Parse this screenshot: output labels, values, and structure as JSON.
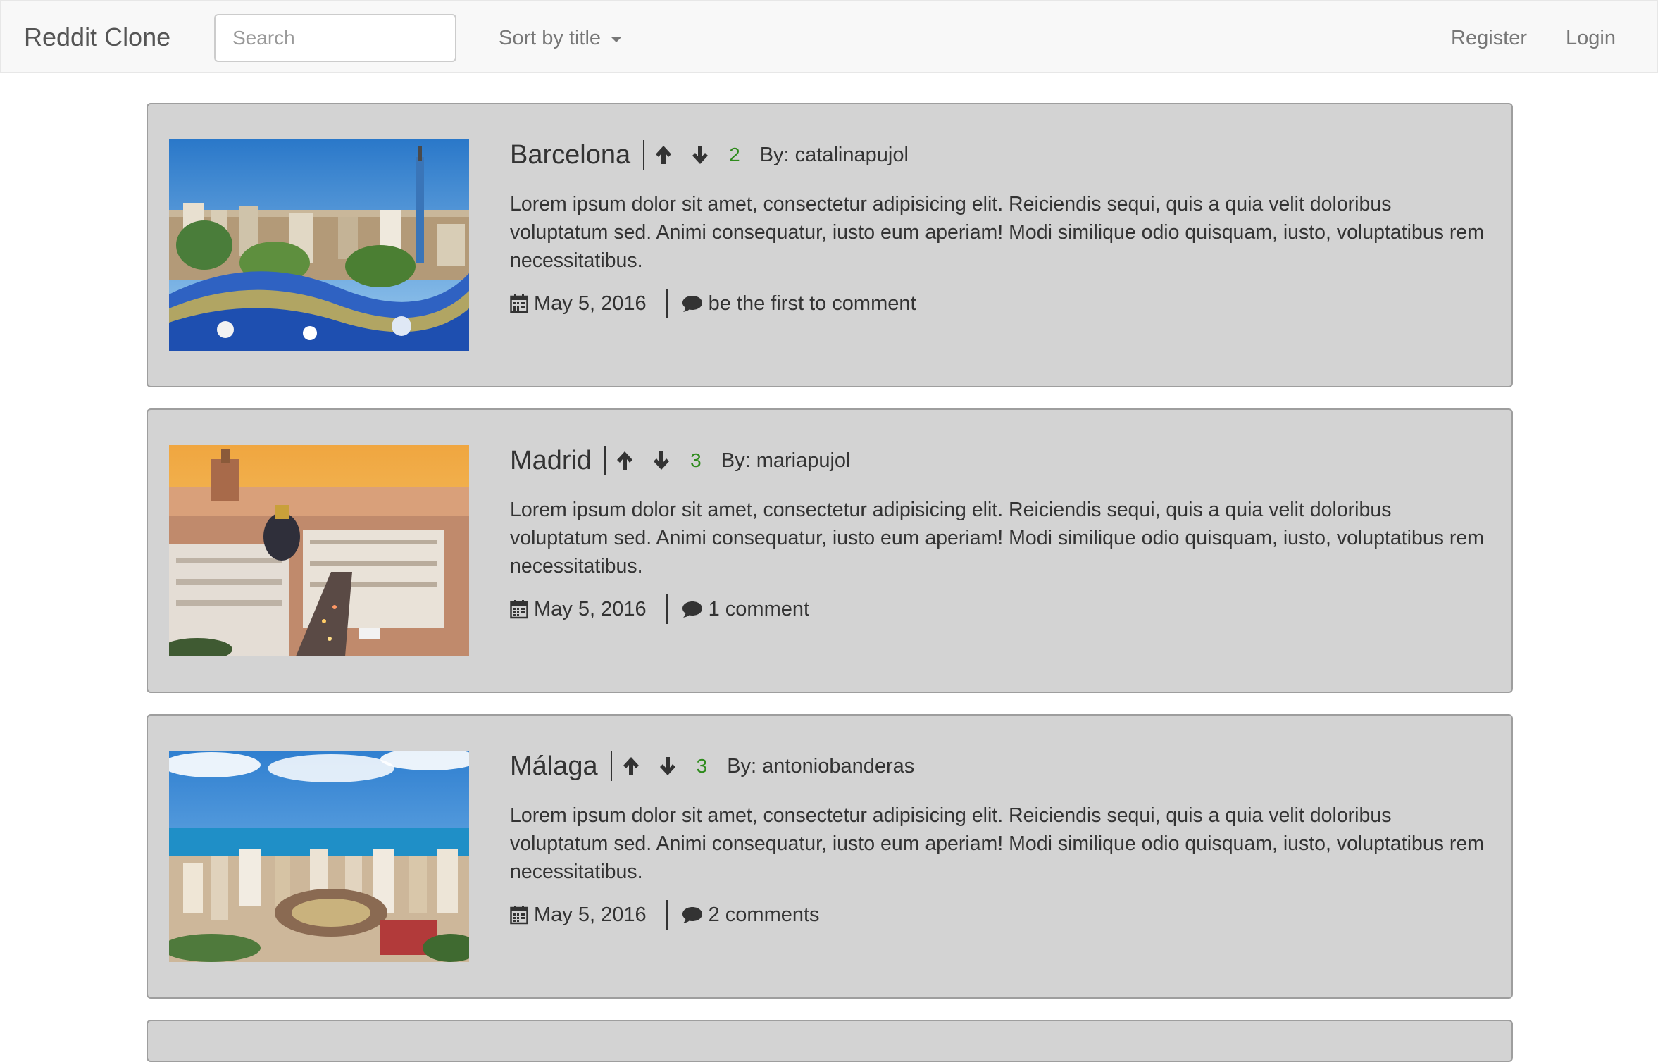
{
  "navbar": {
    "brand": "Reddit Clone",
    "search_placeholder": "Search",
    "sort_label": "Sort by title",
    "register": "Register",
    "login": "Login"
  },
  "posts": [
    {
      "title": "Barcelona",
      "score": "2",
      "author": "By: catalinapujol",
      "body": "Lorem ipsum dolor sit amet, consectetur adipisicing elit. Reiciendis sequi, quis a quia velit doloribus voluptatum sed. Animi consequatur, iusto eum aperiam! Modi similique odio quisquam, iusto, voluptatibus rem necessitatibus.",
      "date": "May 5, 2016",
      "comments": "be the first to comment"
    },
    {
      "title": "Madrid",
      "score": "3",
      "author": "By: mariapujol",
      "body": "Lorem ipsum dolor sit amet, consectetur adipisicing elit. Reiciendis sequi, quis a quia velit doloribus voluptatum sed. Animi consequatur, iusto eum aperiam! Modi similique odio quisquam, iusto, voluptatibus rem necessitatibus.",
      "date": "May 5, 2016",
      "comments": "1 comment"
    },
    {
      "title": "Málaga",
      "score": "3",
      "author": "By: antoniobanderas",
      "body": "Lorem ipsum dolor sit amet, consectetur adipisicing elit. Reiciendis sequi, quis a quia velit doloribus voluptatum sed. Animi consequatur, iusto eum aperiam! Modi similique odio quisquam, iusto, voluptatibus rem necessitatibus.",
      "date": "May 5, 2016",
      "comments": "2 comments"
    }
  ],
  "icons": {
    "upvote": "arrow-up-icon",
    "downvote": "arrow-down-icon",
    "date": "calendar-icon",
    "comments": "comment-icon"
  },
  "colors": {
    "score": "#2e8b1c",
    "card_bg": "#d3d3d3",
    "navbar_bg": "#f8f8f8"
  }
}
